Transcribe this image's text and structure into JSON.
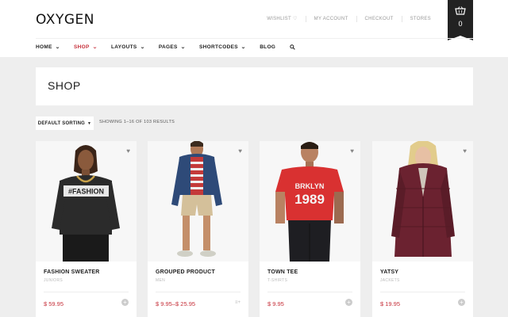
{
  "header": {
    "logo": "OXYGEN",
    "top_links": [
      {
        "label": "WISHLIST",
        "name": "wishlist-link"
      },
      {
        "label": "MY ACCOUNT",
        "name": "my-account-link"
      },
      {
        "label": "CHECKOUT",
        "name": "checkout-link"
      },
      {
        "label": "STORES",
        "name": "stores-link"
      }
    ],
    "cart_count": "0"
  },
  "nav": {
    "items": [
      {
        "label": "HOME",
        "dropdown": true
      },
      {
        "label": "SHOP",
        "dropdown": true,
        "active": true
      },
      {
        "label": "LAYOUTS",
        "dropdown": true
      },
      {
        "label": "PAGES",
        "dropdown": true
      },
      {
        "label": "SHORTCODES",
        "dropdown": true
      },
      {
        "label": "BLOG",
        "dropdown": false
      }
    ]
  },
  "page": {
    "title": "SHOP",
    "sort_label": "DEFAULT SORTING",
    "results_text": "SHOWING 1–16 OF 103 RESULTS"
  },
  "products": [
    {
      "name": "FASHION SWEATER",
      "category": "JUNIORS",
      "price": "$ 59.95"
    },
    {
      "name": "GROUPED PRODUCT",
      "category": "MEN",
      "price": "$ 9.95–$ 25.95"
    },
    {
      "name": "TOWN TEE",
      "category": "T-SHIRTS",
      "price": "$ 9.95"
    },
    {
      "name": "YATSY",
      "category": "JACKETS",
      "price": "$ 19.95"
    }
  ],
  "product_images": {
    "shirt_text_1": "#FASHION",
    "shirt_text_2": "BRKLYN",
    "shirt_text_3": "1989"
  },
  "colors": {
    "accent": "#c6303a",
    "background": "#eeeeee"
  }
}
